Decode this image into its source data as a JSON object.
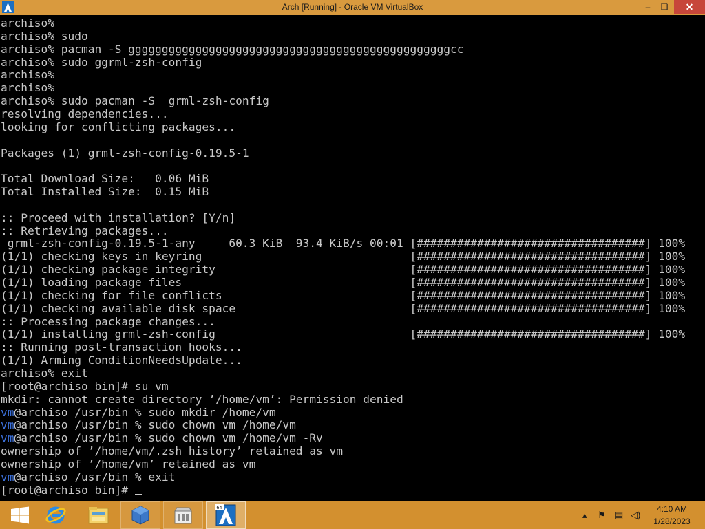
{
  "window": {
    "title": "Arch [Running] - Oracle VM VirtualBox",
    "minimize_glyph": "–",
    "restore_glyph": "❏",
    "close_glyph": "✕"
  },
  "terminal": {
    "lines": [
      "archiso%",
      "archiso% sudo",
      "archiso% pacman -S ggggggggggggggggggggggggggggggggggggggggggggggggcc",
      "archiso% sudo ggrml-zsh-config",
      "archiso%",
      "archiso%",
      "archiso% sudo pacman -S  grml-zsh-config",
      "resolving dependencies...",
      "looking for conflicting packages...",
      "",
      "Packages (1) grml-zsh-config-0.19.5-1",
      "",
      "Total Download Size:   0.06 MiB",
      "Total Installed Size:  0.15 MiB",
      "",
      ":: Proceed with installation? [Y/n]",
      ":: Retrieving packages...",
      " grml-zsh-config-0.19.5-1-any     60.3 KiB  93.4 KiB/s 00:01 [##################################] 100%",
      "(1/1) checking keys in keyring                               [##################################] 100%",
      "(1/1) checking package integrity                             [##################################] 100%",
      "(1/1) loading package files                                  [##################################] 100%",
      "(1/1) checking for file conflicts                            [##################################] 100%",
      "(1/1) checking available disk space                          [##################################] 100%",
      ":: Processing package changes...",
      "(1/1) installing grml-zsh-config                             [##################################] 100%",
      ":: Running post-transaction hooks...",
      "(1/1) Arming ConditionNeedsUpdate...",
      "archiso% exit",
      "[root@archiso bin]# su vm",
      "mkdir: cannot create directory ’/home/vm’: Permission denied",
      "vm@archiso /usr/bin % sudo mkdir /home/vm",
      "vm@archiso /usr/bin % sudo chown vm /home/vm",
      "vm@archiso /usr/bin % sudo chown vm /home/vm -Rv",
      "ownership of ’/home/vm/.zsh_history’ retained as vm",
      "ownership of ’/home/vm’ retained as vm",
      "vm@archiso /usr/bin % exit",
      "[root@archiso bin]# "
    ],
    "user_prompt_lines": [
      30,
      31,
      32,
      35
    ],
    "cursor_line": 36
  },
  "taskbar": {
    "start_icon": "windows-start-icon",
    "pinned": [
      {
        "name": "internet-explorer-icon"
      },
      {
        "name": "file-explorer-icon"
      },
      {
        "name": "virtualbox-manager-icon"
      },
      {
        "name": "store-icon"
      },
      {
        "name": "arch-vm-icon",
        "active": true,
        "badge": "64"
      }
    ],
    "tray_glyphs": {
      "show_hidden": "▴",
      "flag": "⚑",
      "network": "▤",
      "volume": "◁)"
    },
    "clock": {
      "time": "4:10 AM",
      "date": "1/28/2023"
    }
  },
  "colors": {
    "titlebar": "#d99a3e",
    "taskbar": "#d3902f",
    "close_button": "#c7463a",
    "terminal_text": "#c8c8c8",
    "prompt_user": "#3b6fd8"
  }
}
